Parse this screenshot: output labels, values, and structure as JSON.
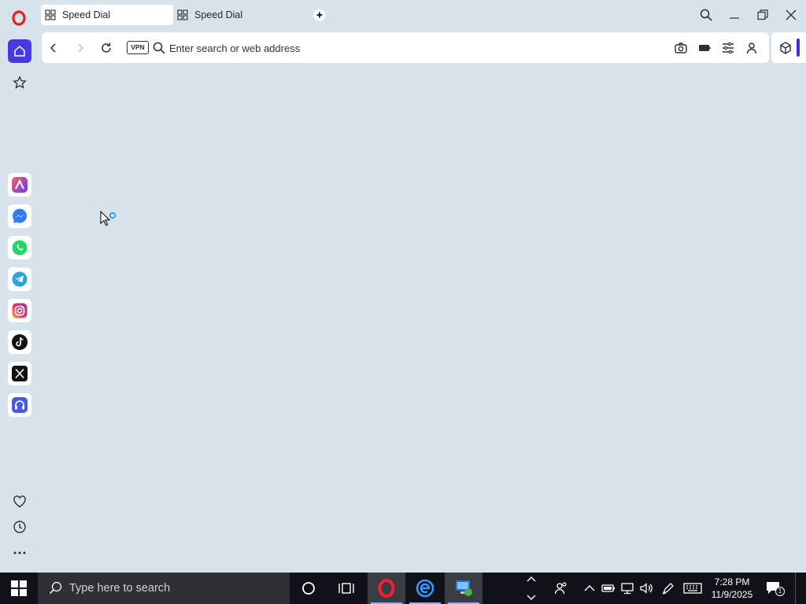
{
  "browser": {
    "tabs": [
      {
        "label": "Speed Dial",
        "active": true
      },
      {
        "label": "Speed Dial",
        "active": false
      }
    ],
    "address": {
      "placeholder": "Enter search or web address",
      "vpn_label": "VPN"
    },
    "accent_color": "#4a38e0"
  },
  "sidebar": {
    "top_items": [
      {
        "name": "home-icon"
      },
      {
        "name": "bookmarks-star-icon"
      }
    ],
    "apps": [
      {
        "name": "aria-icon"
      },
      {
        "name": "messenger-icon"
      },
      {
        "name": "whatsapp-icon"
      },
      {
        "name": "telegram-icon"
      },
      {
        "name": "instagram-icon"
      },
      {
        "name": "tiktok-icon"
      },
      {
        "name": "x-twitter-icon"
      },
      {
        "name": "music-player-icon"
      }
    ],
    "bottom_items": [
      {
        "name": "heart-icon"
      },
      {
        "name": "history-icon"
      },
      {
        "name": "more-icon"
      }
    ]
  },
  "taskbar": {
    "search_placeholder": "Type here to search",
    "time": "7:28 PM",
    "date": "11/9/2025",
    "notification_count": "1"
  }
}
